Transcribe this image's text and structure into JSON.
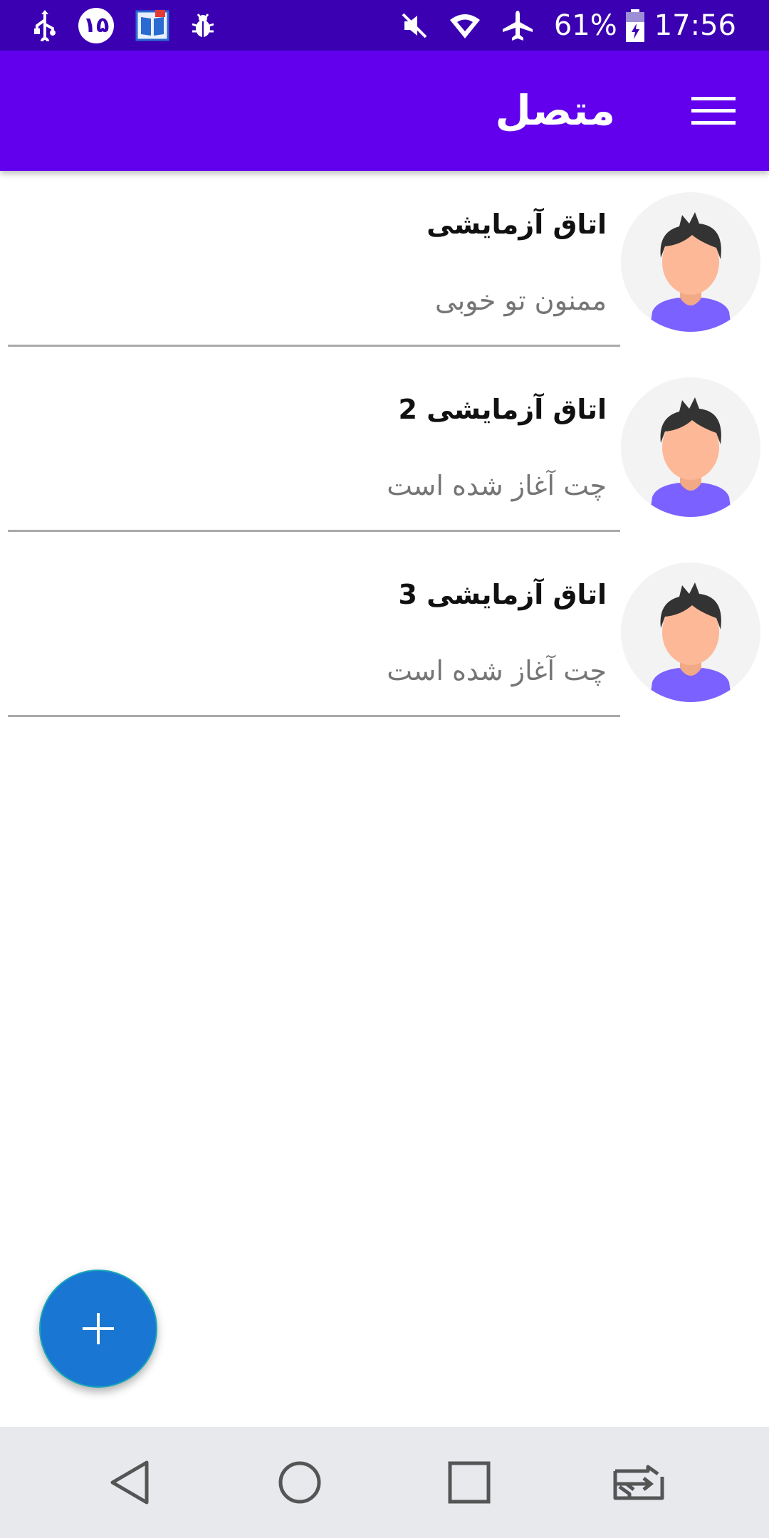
{
  "status_bar": {
    "notification_badge": "۱۵",
    "battery": "61%",
    "time": "17:56",
    "icons": [
      "usb-icon",
      "notification-count-icon",
      "dictionary-app-icon",
      "bug-icon",
      "mute-icon",
      "wifi-icon",
      "airplane-icon",
      "battery-charging-icon"
    ]
  },
  "app_bar": {
    "title": "متصل",
    "background": "#6200ee"
  },
  "chats": [
    {
      "title": "اتاق آزمایشی",
      "subtitle": "ممنون تو خوبی"
    },
    {
      "title": "اتاق آزمایشی 2",
      "subtitle": "چت آغاز شده است"
    },
    {
      "title": "اتاق آزمایشی 3",
      "subtitle": "چت آغاز شده است"
    }
  ],
  "fab": {
    "icon": "plus-icon",
    "color": "#1976d2"
  },
  "nav_bar": {
    "buttons": [
      "back-icon",
      "home-icon",
      "recents-icon",
      "switch-app-icon"
    ]
  }
}
